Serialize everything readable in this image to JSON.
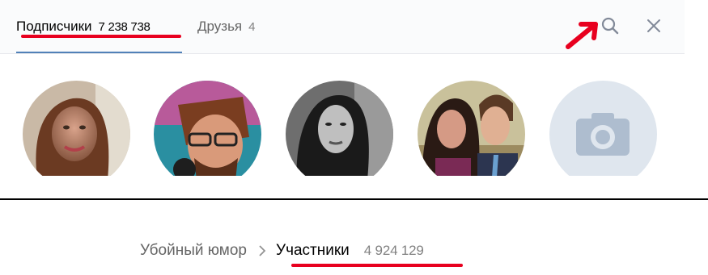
{
  "tabs": {
    "followers": {
      "label": "Подписчики",
      "count": "7 238 738"
    },
    "friends": {
      "label": "Друзья",
      "count": "4"
    }
  },
  "icons": {
    "search": "search-icon",
    "close": "close-icon",
    "camera": "camera-icon",
    "chevron": "chevron-right-icon",
    "arrow": "red-arrow-annotation"
  },
  "avatars": [
    {
      "description": "woman-red-hair"
    },
    {
      "description": "man-glasses"
    },
    {
      "description": "woman-bw"
    },
    {
      "description": "couple"
    },
    {
      "description": "placeholder-camera"
    }
  ],
  "breadcrumb": {
    "group": "Убойный юмор",
    "current": "Участники",
    "count": "4 924 129"
  },
  "colors": {
    "accent": "#5181b8",
    "annotation": "#e8001f",
    "muted_text": "#828282"
  }
}
